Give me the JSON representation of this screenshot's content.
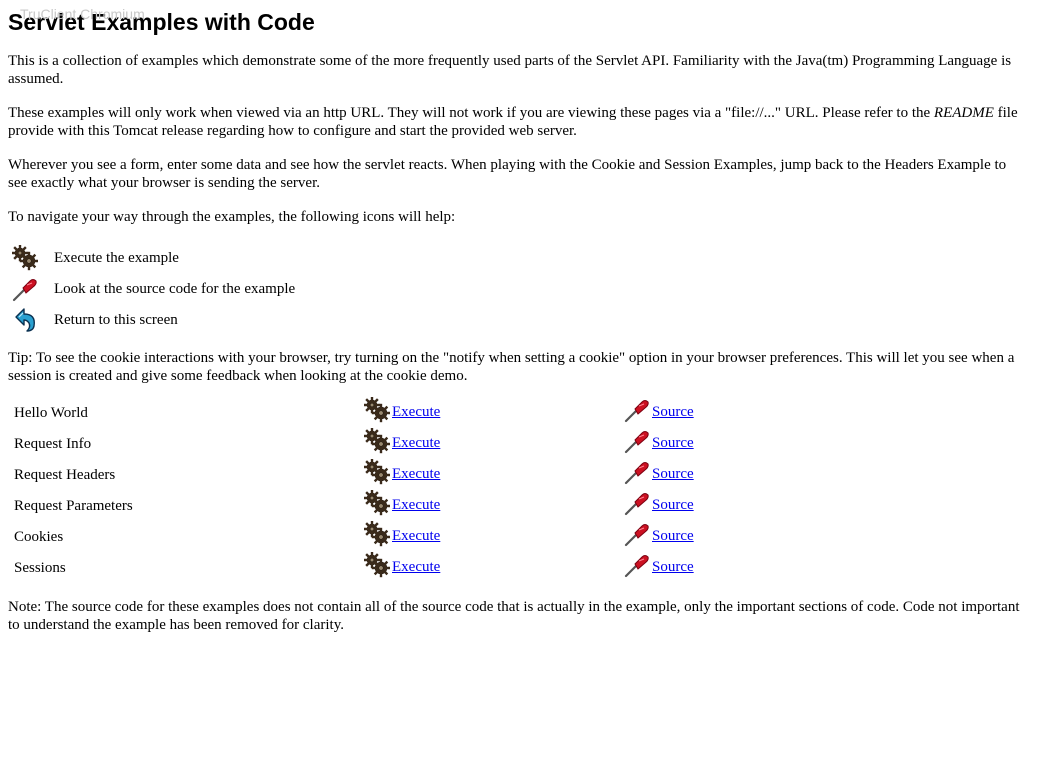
{
  "watermark": "TruClient Chromium",
  "page": {
    "title": "Servlet Examples with Code",
    "paragraphs": {
      "intro": "This is a collection of examples which demonstrate some of the more frequently used parts of the Servlet API. Familiarity with the Java(tm) Programming Language is assumed.",
      "url_before": "These examples will only work when viewed via an http URL. They will not work if you are viewing these pages via a \"file://...\" URL. Please refer to the ",
      "url_readme": "README",
      "url_after": " file provide with this Tomcat release regarding how to configure and start the provided web server.",
      "form": "Wherever you see a form, enter some data and see how the servlet reacts. When playing with the Cookie and Session Examples, jump back to the Headers Example to see exactly what your browser is sending the server.",
      "navigate": "To navigate your way through the examples, the following icons will help:"
    },
    "legend": [
      {
        "icon": "gears-icon",
        "label": "Execute the example"
      },
      {
        "icon": "screwdriver-icon",
        "label": "Look at the source code for the example"
      },
      {
        "icon": "return-arrow-icon",
        "label": "Return to this screen"
      }
    ],
    "tip": "Tip: To see the cookie interactions with your browser, try turning on the \"notify when setting a cookie\" option in your browser preferences. This will let you see when a session is created and give some feedback when looking at the cookie demo.",
    "examples": [
      {
        "name": "Hello World",
        "execute": "Execute",
        "source": "Source"
      },
      {
        "name": "Request Info",
        "execute": "Execute",
        "source": "Source"
      },
      {
        "name": "Request Headers",
        "execute": "Execute",
        "source": "Source"
      },
      {
        "name": "Request Parameters",
        "execute": "Execute",
        "source": "Source"
      },
      {
        "name": "Cookies",
        "execute": "Execute",
        "source": "Source"
      },
      {
        "name": "Sessions",
        "execute": "Execute",
        "source": "Source"
      }
    ],
    "note": "Note: The source code for these examples does not contain all of the source code that is actually in the example, only the important sections of code. Code not important to understand the example has been removed for clarity."
  },
  "colors": {
    "link": "#0000ee",
    "watermark": "#c8c8c8",
    "gear": "#3a2a1a",
    "screwdriver_handle": "#cc1122",
    "arrow": "#2aa0d0"
  }
}
